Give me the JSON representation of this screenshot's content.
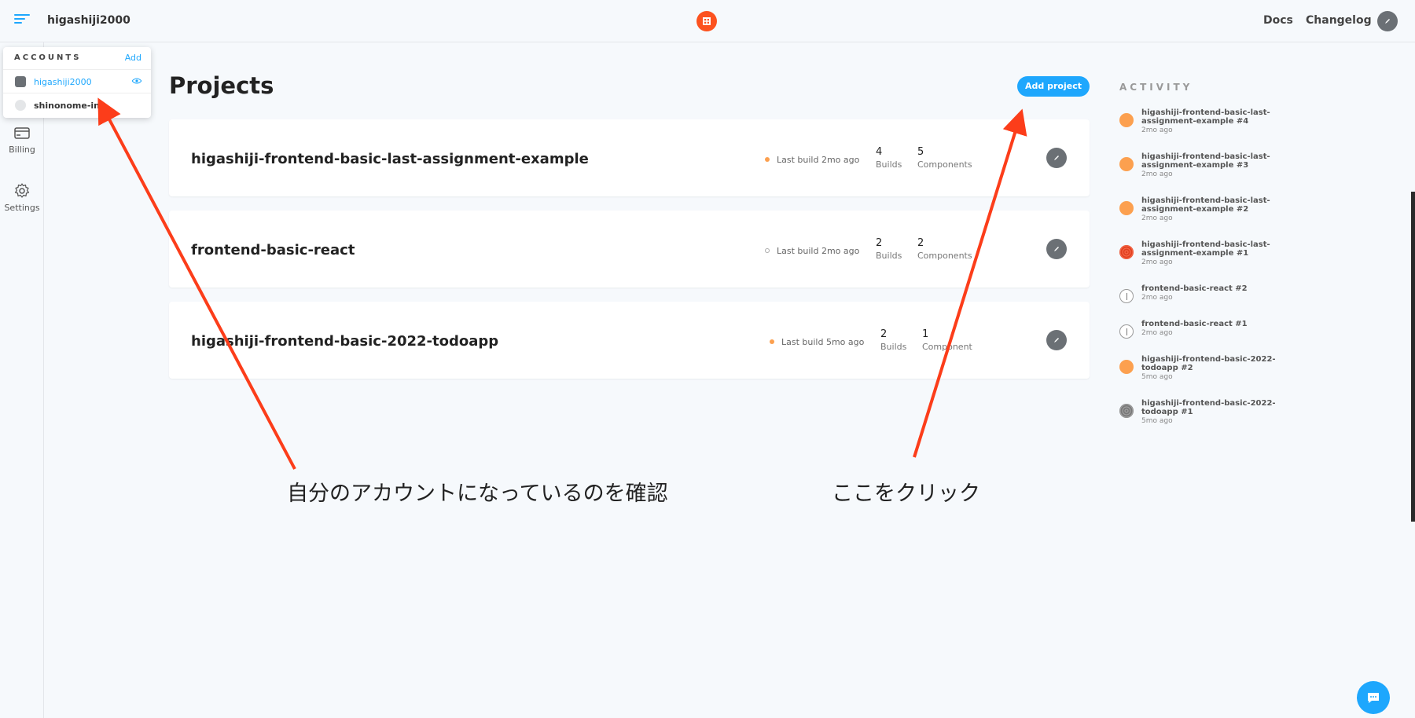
{
  "header": {
    "account_name": "higashiji2000",
    "logo_icon": "storybook-logo-icon",
    "links": {
      "docs": "Docs",
      "changelog": "Changelog"
    }
  },
  "sidebar": {
    "items": [
      {
        "label": "Billing",
        "icon": "credit-card-icon"
      },
      {
        "label": "Settings",
        "icon": "gear-icon"
      }
    ]
  },
  "accounts_menu": {
    "header": "ACCOUNTS",
    "add_label": "Add",
    "accounts": [
      {
        "name": "higashiji2000",
        "selected": true
      },
      {
        "name": "shinonome-inc",
        "selected": false
      }
    ]
  },
  "main": {
    "title": "Projects",
    "add_project_label": "Add project",
    "projects": [
      {
        "name": "higashiji-frontend-basic-last-assignment-example",
        "status_text": "Last build 2mo ago",
        "status_color": "#fca04f",
        "builds": "4",
        "builds_label": "Builds",
        "components": "5",
        "components_label": "Components"
      },
      {
        "name": "frontend-basic-react",
        "status_text": "Last build 2mo ago",
        "status_color": "#b0b4b8",
        "builds": "2",
        "builds_label": "Builds",
        "components": "2",
        "components_label": "Components"
      },
      {
        "name": "higashiji-frontend-basic-2022-todoapp",
        "status_text": "Last build 5mo ago",
        "status_color": "#fca04f",
        "builds": "2",
        "builds_label": "Builds",
        "components": "1",
        "components_label": "Component"
      }
    ]
  },
  "activity": {
    "title": "ACTIVITY",
    "items": [
      {
        "text": "higashiji-frontend-basic-last-assignment-example #4",
        "time": "2mo ago",
        "status": "orange"
      },
      {
        "text": "higashiji-frontend-basic-last-assignment-example #3",
        "time": "2mo ago",
        "status": "orange"
      },
      {
        "text": "higashiji-frontend-basic-last-assignment-example #2",
        "time": "2mo ago",
        "status": "orange"
      },
      {
        "text": "higashiji-frontend-basic-last-assignment-example #1",
        "time": "2mo ago",
        "status": "red"
      },
      {
        "text": "frontend-basic-react #2",
        "time": "2mo ago",
        "status": "pending"
      },
      {
        "text": "frontend-basic-react #1",
        "time": "2mo ago",
        "status": "pending"
      },
      {
        "text": "higashiji-frontend-basic-2022-todoapp #2",
        "time": "5mo ago",
        "status": "orange"
      },
      {
        "text": "higashiji-frontend-basic-2022-todoapp #1",
        "time": "5mo ago",
        "status": "gray"
      }
    ]
  },
  "annotations": {
    "left": "自分のアカウントになっているのを確認",
    "right": "ここをクリック",
    "arrow_color": "#fc3d1a"
  },
  "colors": {
    "accent": "#1ea7fd",
    "brand": "#fc521f",
    "warning": "#fca04f"
  }
}
